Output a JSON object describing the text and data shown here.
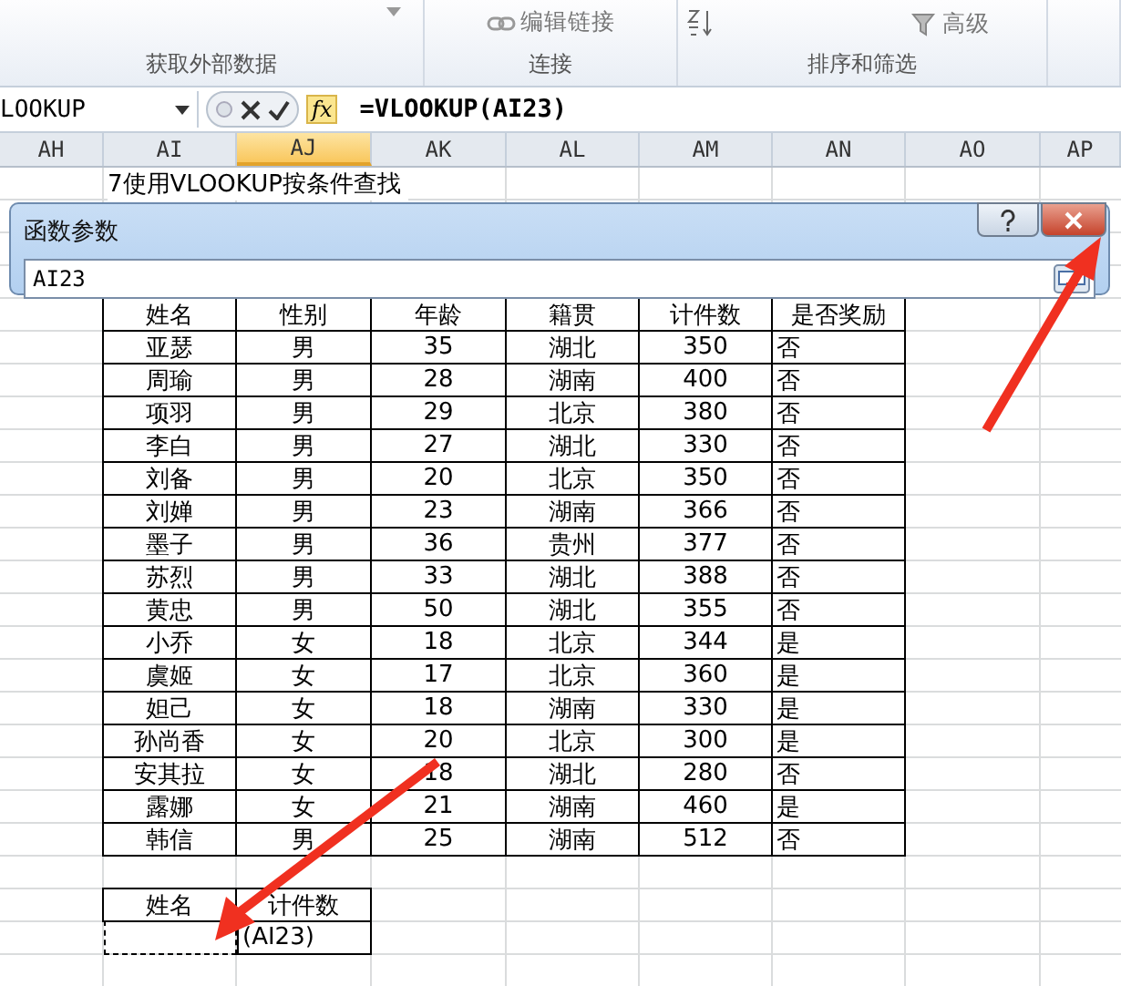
{
  "ribbon": {
    "buttons": [
      {
        "label": "编辑链接",
        "kind": "link"
      },
      {
        "label": "高级",
        "kind": "filter"
      }
    ],
    "groups": [
      "获取外部数据",
      "连接",
      "排序和筛选"
    ]
  },
  "formula_bar": {
    "name_box": "LOOKUP",
    "function_button": "fx",
    "formula": "=VLOOKUP(AI23)"
  },
  "columns": [
    {
      "label": "AH",
      "selected": false
    },
    {
      "label": "AI",
      "selected": false
    },
    {
      "label": "AJ",
      "selected": true
    },
    {
      "label": "AK",
      "selected": false
    },
    {
      "label": "AL",
      "selected": false
    },
    {
      "label": "AM",
      "selected": false
    },
    {
      "label": "AN",
      "selected": false
    },
    {
      "label": "AO",
      "selected": false
    },
    {
      "label": "AP",
      "selected": false
    }
  ],
  "sheet_title": "7使用VLOOKUP按条件查找",
  "dialog": {
    "title": "函数参数",
    "value": "AI23"
  },
  "table": {
    "columns": [
      "姓名",
      "性别",
      "年龄",
      "籍贯",
      "计件数",
      "是否奖励"
    ],
    "rows": [
      [
        "亚瑟",
        "男",
        "35",
        "湖北",
        "350",
        "否"
      ],
      [
        "周瑜",
        "男",
        "28",
        "湖南",
        "400",
        "否"
      ],
      [
        "项羽",
        "男",
        "29",
        "北京",
        "380",
        "否"
      ],
      [
        "李白",
        "男",
        "27",
        "湖北",
        "330",
        "否"
      ],
      [
        "刘备",
        "男",
        "20",
        "北京",
        "350",
        "否"
      ],
      [
        "刘婵",
        "男",
        "23",
        "湖南",
        "366",
        "否"
      ],
      [
        "墨子",
        "男",
        "36",
        "贵州",
        "377",
        "否"
      ],
      [
        "苏烈",
        "男",
        "33",
        "湖北",
        "388",
        "否"
      ],
      [
        "黄忠",
        "男",
        "50",
        "湖北",
        "355",
        "否"
      ],
      [
        "小乔",
        "女",
        "18",
        "北京",
        "344",
        "是"
      ],
      [
        "虞姬",
        "女",
        "17",
        "北京",
        "360",
        "是"
      ],
      [
        "妲己",
        "女",
        "18",
        "湖南",
        "330",
        "是"
      ],
      [
        "孙尚香",
        "女",
        "20",
        "北京",
        "300",
        "是"
      ],
      [
        "安其拉",
        "女",
        "18",
        "湖北",
        "280",
        "否"
      ],
      [
        "露娜",
        "女",
        "21",
        "湖南",
        "460",
        "是"
      ],
      [
        "韩信",
        "男",
        "25",
        "湖南",
        "512",
        "否"
      ]
    ]
  },
  "lookup": {
    "headers": [
      "姓名",
      "计件数"
    ],
    "result": "(AI23)"
  }
}
